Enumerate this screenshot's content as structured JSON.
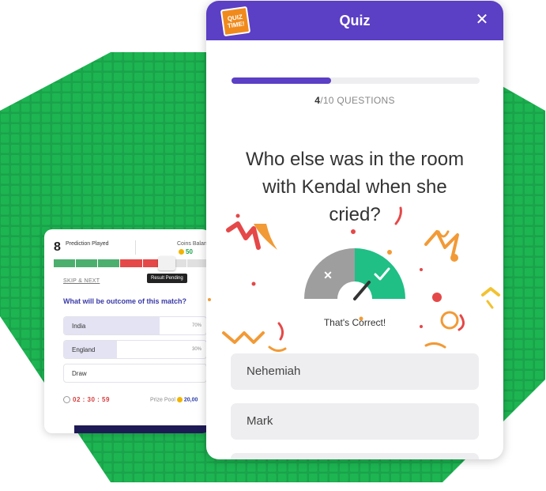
{
  "prediction_card": {
    "predictions_count": "8",
    "predictions_label": "Prediction Played",
    "coins_label": "Coins Balan",
    "coins_value": "50",
    "tooltip": "Result Pending",
    "skip_label": "SKIP & NEXT",
    "question": "What will be outcome of this match?",
    "options": [
      {
        "label": "India",
        "percent_text": "70%",
        "percent": 70
      },
      {
        "label": "England",
        "percent_text": "30%",
        "percent": 30
      },
      {
        "label": "Draw",
        "percent_text": "",
        "percent": 0
      }
    ],
    "timer": "02 : 30 : 59",
    "prize_pool_label": "Prize Pool",
    "prize_pool_value": "20,00"
  },
  "quiz": {
    "title": "Quiz",
    "logo_text_1": "QUIZ",
    "logo_text_2": "TIME!",
    "progress": 0.4,
    "current_question": "4",
    "total_questions": "/10 QUESTIONS",
    "question": "Who else was in the room with Kendal when she cried?",
    "result_text": "That's Correct!",
    "answers": [
      "Nehemiah",
      "Mark",
      ""
    ]
  },
  "colors": {
    "brand_purple": "#5b3fc4",
    "backdrop_green": "#1aa34a",
    "correct_green": "#1fbf86",
    "wrong_grey": "#9e9e9e"
  }
}
